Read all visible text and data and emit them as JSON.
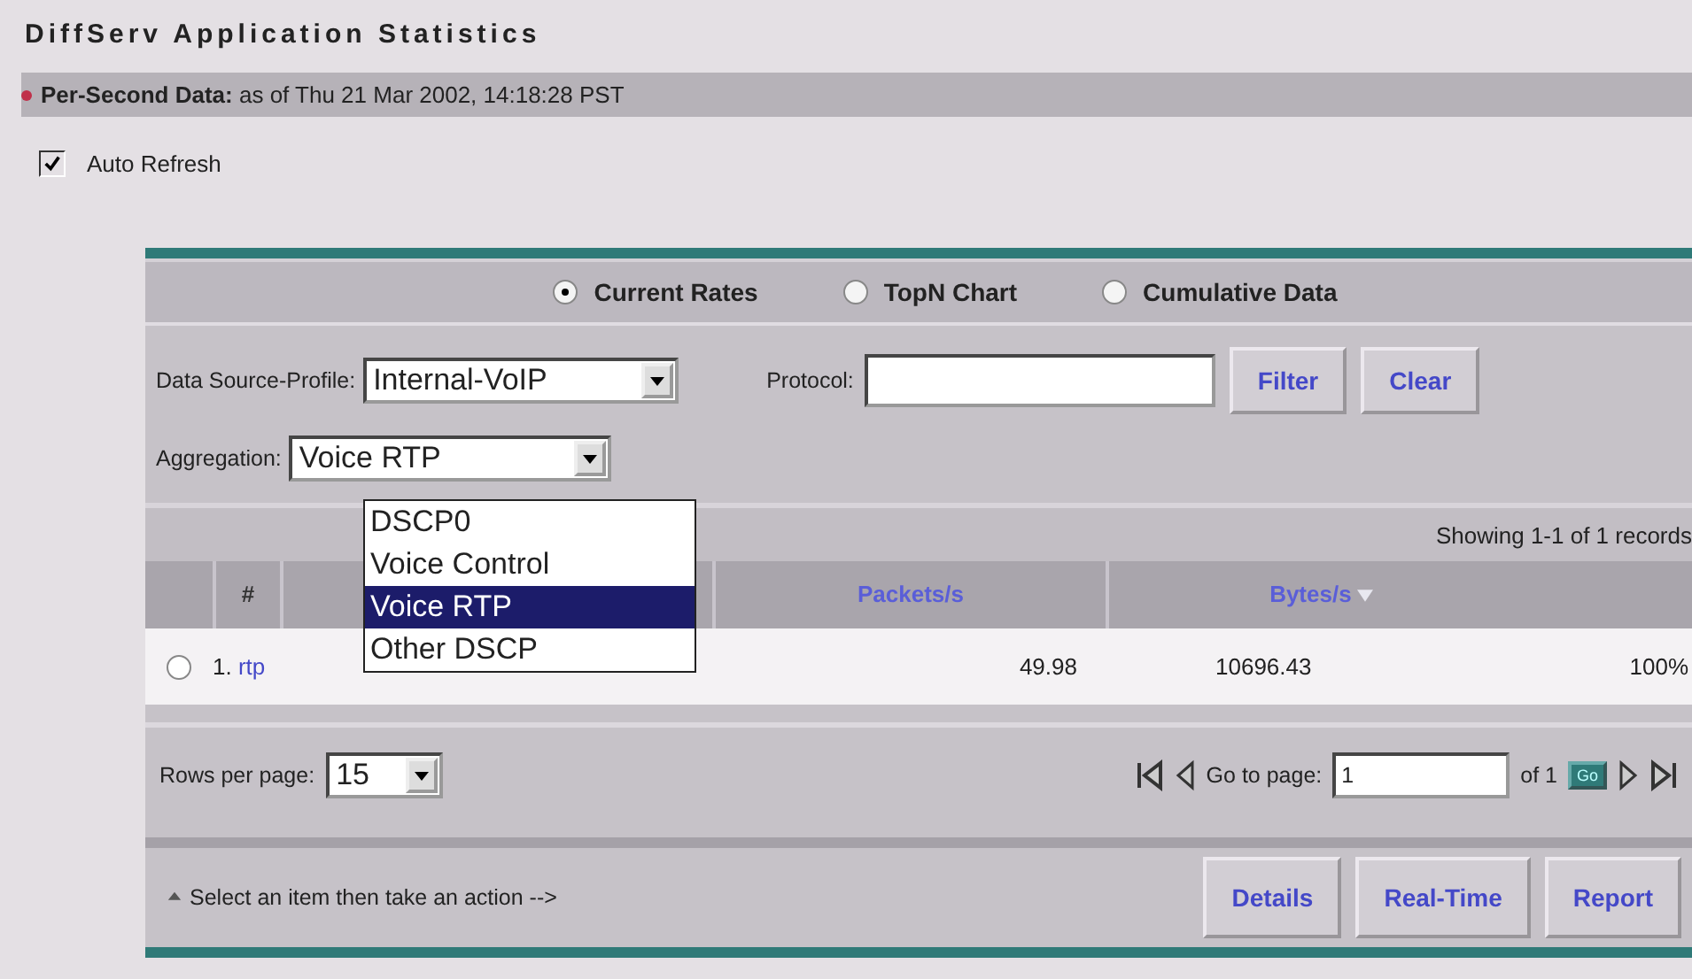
{
  "title": "DiffServ Application Statistics",
  "data_header": {
    "label": "Per-Second Data:",
    "text": "as of Thu 21 Mar 2002, 14:18:28 PST"
  },
  "auto_refresh": {
    "label": "Auto Refresh",
    "checked": true
  },
  "views": [
    {
      "label": "Current Rates",
      "selected": true
    },
    {
      "label": "TopN Chart",
      "selected": false
    },
    {
      "label": "Cumulative Data",
      "selected": false
    }
  ],
  "filters": {
    "profile_label": "Data Source-Profile:",
    "profile_value": "Internal-VoIP",
    "protocol_label": "Protocol:",
    "buttons": [
      "Filter",
      "Clear"
    ]
  },
  "aggregation": {
    "label": "Aggregation:",
    "value": "Voice RTP",
    "expanded": true,
    "options": [
      {
        "label": "DSCP0",
        "selected": false
      },
      {
        "label": "Voice Control",
        "selected": false
      },
      {
        "label": "Voice RTP",
        "selected": true
      },
      {
        "label": "Other DSCP",
        "selected": false
      }
    ]
  },
  "records_text": "Showing 1-1 of 1 records",
  "table": {
    "columns": [
      "#",
      "Packets/s",
      "Bytes/s"
    ],
    "rows": [
      {
        "selected": false,
        "index": "1.",
        "name": "rtp",
        "packets": "49.98",
        "bytes": "10696.43",
        "share": "100%"
      }
    ]
  },
  "pagination": {
    "rows_label": "Rows per page:",
    "rows_value": "15",
    "goto_label": "Go to page:",
    "page": "1",
    "of_text": "of 1",
    "go": "Go"
  },
  "actions": {
    "hint": "Select an item then take an action -->",
    "buttons": [
      "Details",
      "Real-Time",
      "Report"
    ]
  }
}
